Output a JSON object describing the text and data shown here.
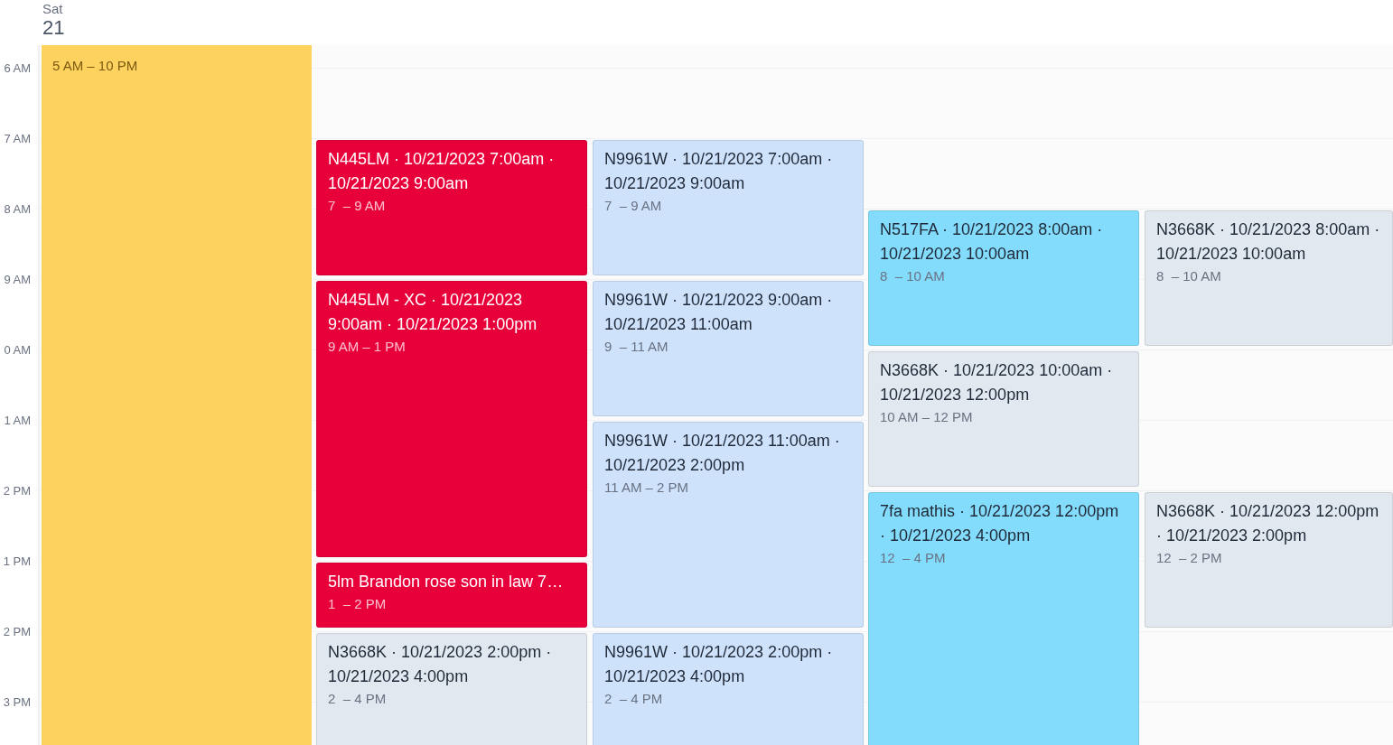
{
  "day_header": {
    "weekday": "Sat",
    "date": "21"
  },
  "time_labels": [
    "6 AM",
    "7 AM",
    "8 AM",
    "9 AM",
    "0 AM",
    "1 AM",
    "2 PM",
    "1 PM",
    "2 PM",
    "3 PM"
  ],
  "columns": [
    {
      "events": [
        {
          "time": "5 AM – 10 PM",
          "color": "#fed25f"
        }
      ]
    },
    {
      "events": [
        {
          "title": "N445LM · 10/21/2023 7:00am · 10/21/2023 9:00am",
          "time": "7  – 9 AM",
          "color": "#e8003a"
        },
        {
          "title": "N445LM - XC · 10/21/2023 9:00am · 10/21/2023 1:00pm",
          "time": "9 AM – 1 PM",
          "color": "#e8003a"
        },
        {
          "title": "5lm Brandon rose son in law 7…",
          "time": "1  – 2 PM",
          "color": "#e8003a"
        },
        {
          "title": "N3668K · 10/21/2023 2:00pm · 10/21/2023 4:00pm",
          "time": "2  – 4 PM",
          "color": "#e2e8f0"
        }
      ]
    },
    {
      "events": [
        {
          "title": "N9961W · 10/21/2023 7:00am · 10/21/2023 9:00am",
          "time": "7  – 9 AM",
          "color": "#cfe2fc"
        },
        {
          "title": "N9961W · 10/21/2023 9:00am · 10/21/2023 11:00am",
          "time": "9  – 11 AM",
          "color": "#cfe2fc"
        },
        {
          "title": "N9961W · 10/21/2023 11:00am · 10/21/2023 2:00pm",
          "time": "11 AM – 2 PM",
          "color": "#cfe2fc"
        },
        {
          "title": "N9961W · 10/21/2023 2:00pm · 10/21/2023 4:00pm",
          "time": "2  – 4 PM",
          "color": "#cfe2fc"
        }
      ]
    },
    {
      "events": [
        {
          "title": "N517FA · 10/21/2023 8:00am · 10/21/2023 10:00am",
          "time": "8  – 10 AM",
          "color": "#84dcfd"
        },
        {
          "title": "N3668K · 10/21/2023 10:00am · 10/21/2023 12:00pm",
          "time": "10 AM – 12 PM",
          "color": "#e2e8f0"
        },
        {
          "title": "7fa mathis · 10/21/2023 12:00pm · 10/21/2023 4:00pm",
          "time": "12  – 4 PM",
          "color": "#84dcfd"
        }
      ]
    },
    {
      "events": [
        {
          "title": "N3668K · 10/21/2023 8:00am · 10/21/2023 10:00am",
          "time": "8  – 10 AM",
          "color": "#e2e8f0"
        },
        {
          "title": "N3668K · 10/21/2023 12:00pm · 10/21/2023 2:00pm",
          "time": "12  – 2 PM",
          "color": "#e2e8f0"
        }
      ]
    }
  ]
}
